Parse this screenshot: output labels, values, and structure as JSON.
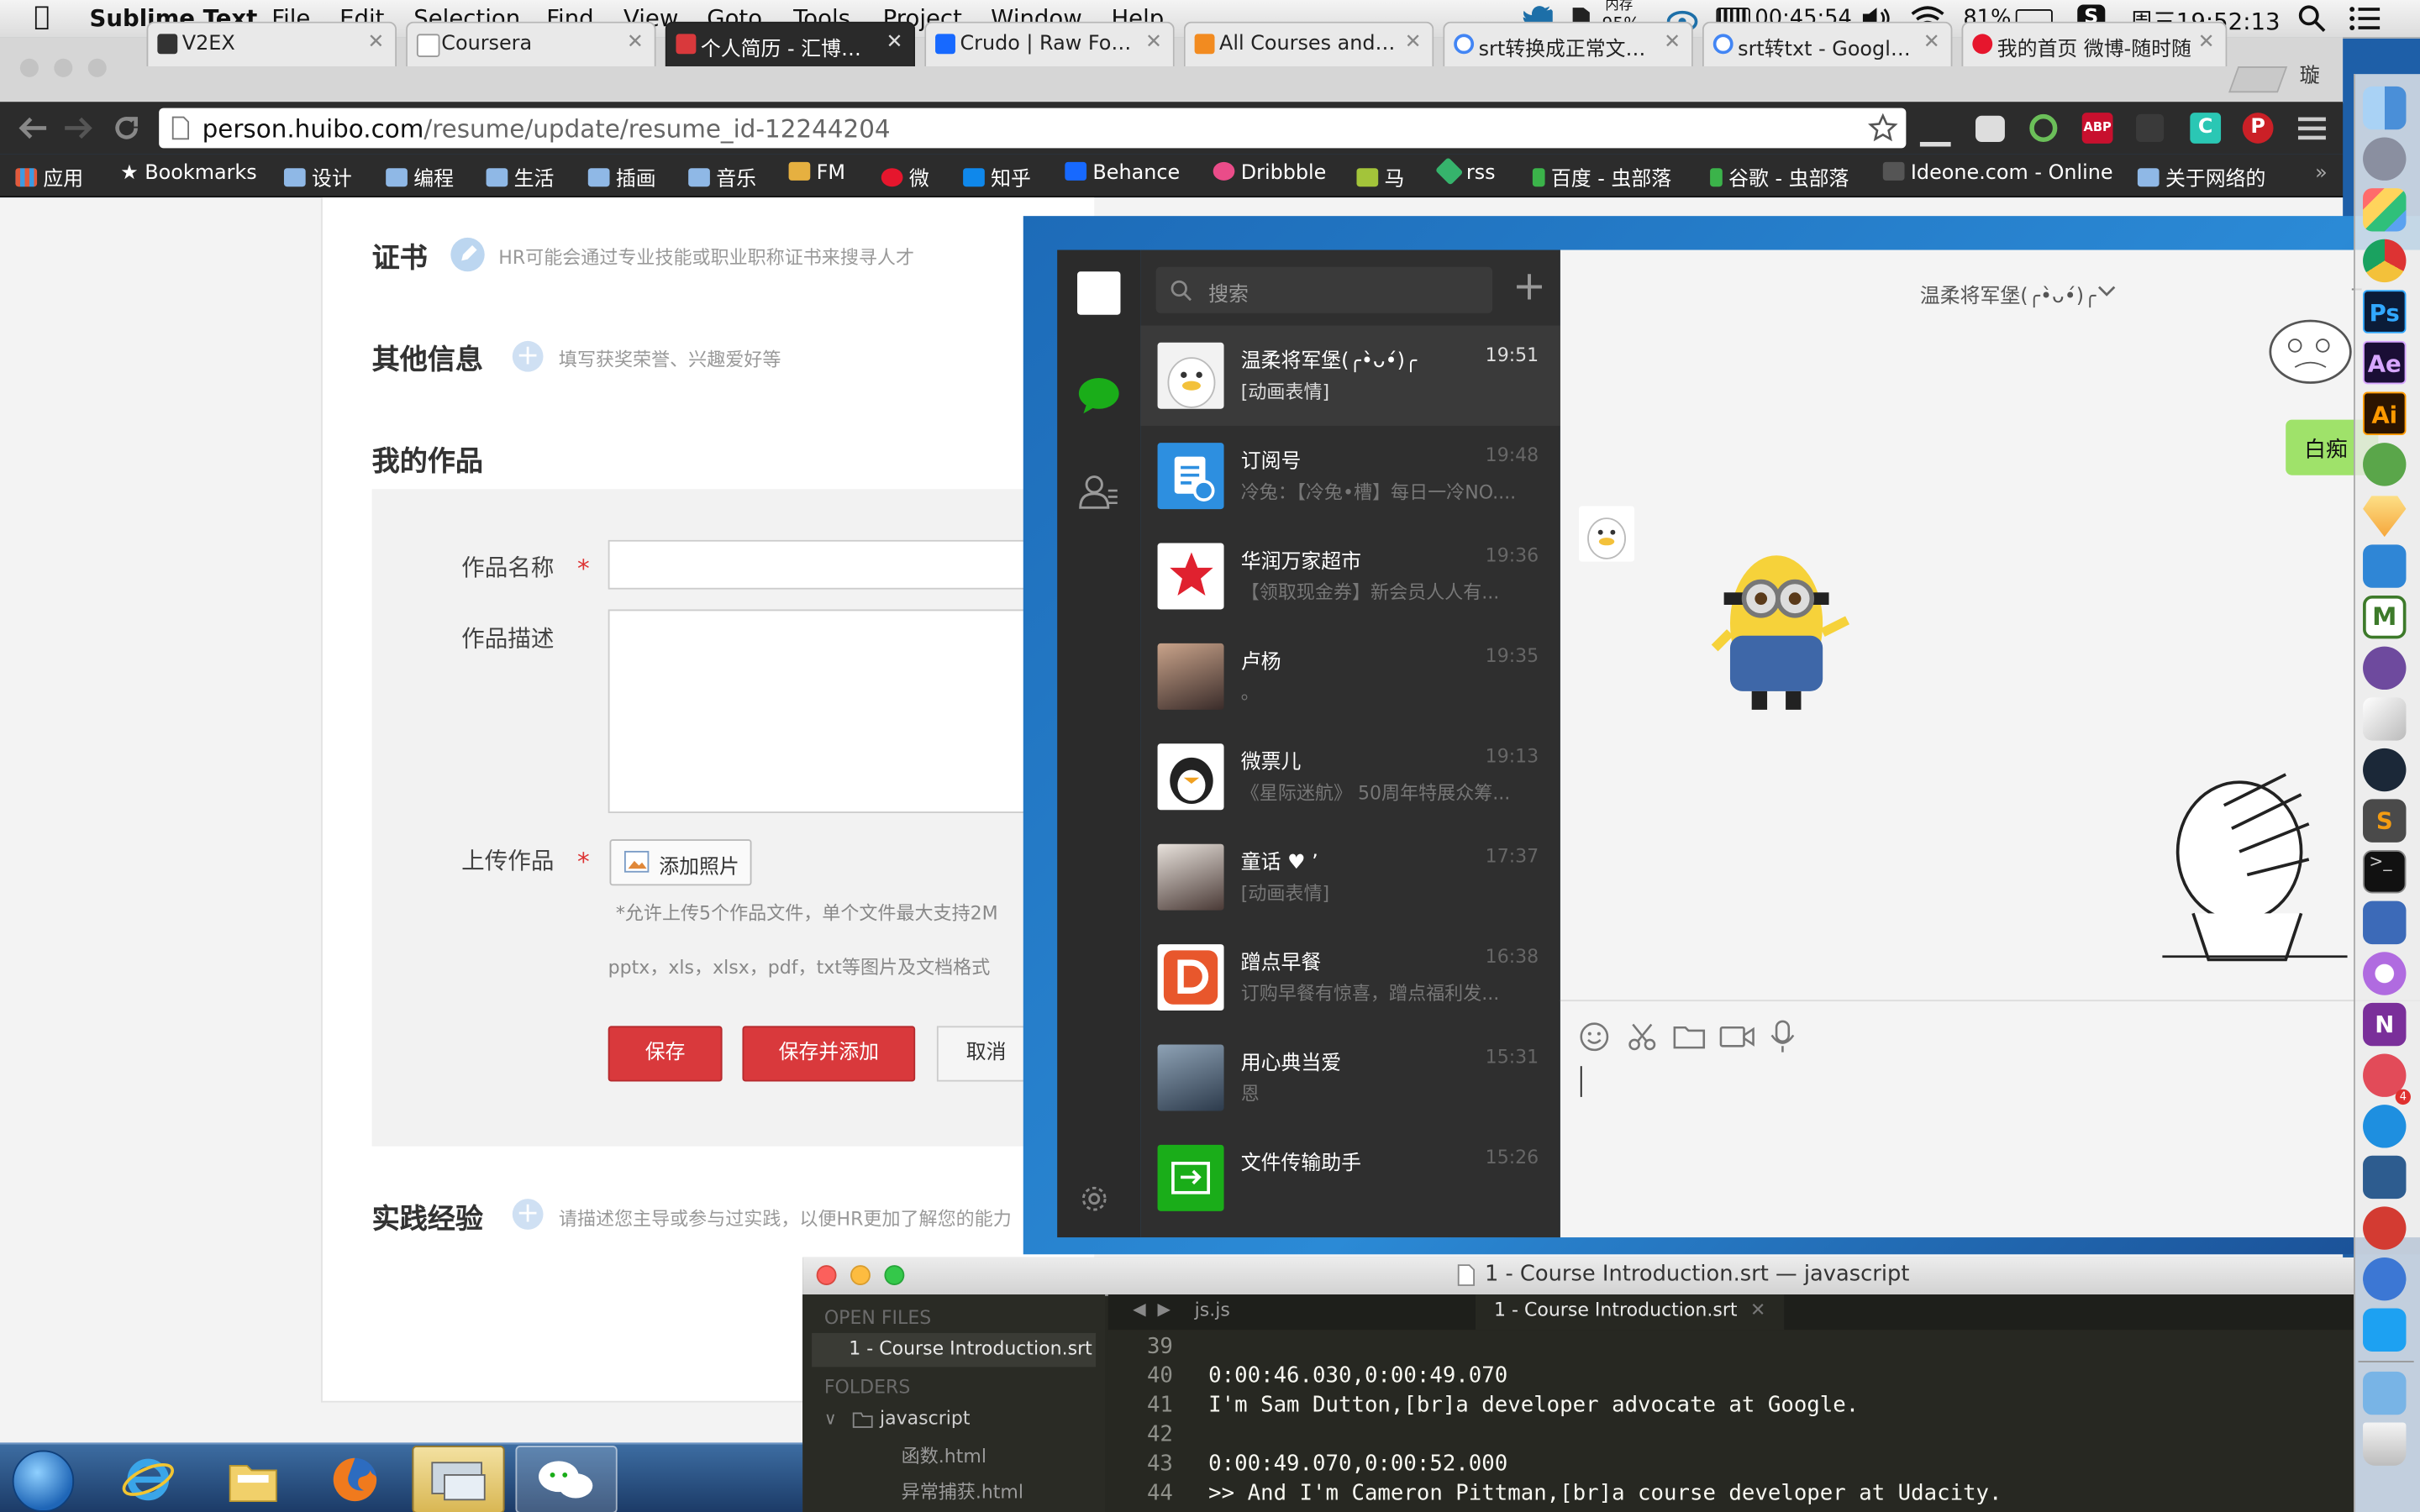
{
  "menubar": {
    "app": "Sublime Text",
    "items": [
      "File",
      "Edit",
      "Selection",
      "Find",
      "View",
      "Goto",
      "Tools",
      "Project",
      "Window",
      "Help"
    ],
    "mem_label": "内存",
    "mem_value": "95%",
    "timer": "00:45:54",
    "battery": "81%",
    "clock": "周三19:52:13"
  },
  "browser": {
    "tabs": [
      {
        "title": "V2EX",
        "favicon_color": "#333333"
      },
      {
        "title": "Coursera",
        "favicon_color": "#ffffff"
      },
      {
        "title": "个人简历 - 汇博人才网",
        "favicon_color": "#d9393c"
      },
      {
        "title": "Crudo | Raw Food F",
        "favicon_color": "#1769ff"
      },
      {
        "title": "All Courses and Na",
        "favicon_color": "#f28b20"
      },
      {
        "title": "srt转换成正常文本 -",
        "favicon_color": "#ffffff"
      },
      {
        "title": "srt转txt - Google 搜",
        "favicon_color": "#ffffff"
      },
      {
        "title": "我的首页 微博-随时随",
        "favicon_color": "#e6162d"
      }
    ],
    "new_tab_label": "璇",
    "url_host": "person.huibo.com",
    "url_path": "/resume/update/resume_id-12244204",
    "bookmarks": [
      {
        "label": "应用",
        "type": "apps"
      },
      {
        "label": "Bookmarks",
        "type": "star"
      },
      {
        "label": "设计",
        "type": "folder"
      },
      {
        "label": "编程",
        "type": "folder"
      },
      {
        "label": "生活",
        "type": "folder"
      },
      {
        "label": "插画",
        "type": "folder"
      },
      {
        "label": "音乐",
        "type": "folder"
      },
      {
        "label": "FM",
        "type": "fm"
      },
      {
        "label": "微",
        "type": "weibo"
      },
      {
        "label": "知乎",
        "type": "zhihu"
      },
      {
        "label": "Behance",
        "type": "behance"
      },
      {
        "label": "Dribbble",
        "type": "dribbble"
      },
      {
        "label": "马",
        "type": "ma"
      },
      {
        "label": "rss",
        "type": "rss"
      },
      {
        "label": "百度 - 虫部落",
        "type": "chong"
      },
      {
        "label": "谷歌 - 虫部落",
        "type": "chong"
      },
      {
        "label": "Ideone.com - Online",
        "type": "ideone"
      },
      {
        "label": "关于网络的",
        "type": "folder"
      }
    ]
  },
  "page": {
    "cert_title": "证书",
    "cert_hint": "HR可能会通过专业技能或职业职称证书来搜寻人才",
    "other_title": "其他信息",
    "other_hint": "填写获奖荣誉、兴趣爱好等",
    "works_title": "我的作品",
    "name_label": "作品名称",
    "desc_label": "作品描述",
    "upload_label": "上传作品",
    "required_mark": "*",
    "add_photo": "添加照片",
    "upload_note1": "*允许上传5个作品文件，单个文件最大支持2M",
    "upload_note2": "pptx，xls，xlsx，pdf，txt等图片及文档格式",
    "save": "保存",
    "save_add": "保存并添加",
    "cancel": "取消",
    "practice_title": "实践经验",
    "practice_hint": "请描述您主导或参与过实践，以便HR更加了解您的能力"
  },
  "wechat": {
    "search_placeholder": "搜索",
    "chat_title": "温柔将军堡(╭•̀ᴗ•́)╭",
    "bubble_text": "白痴",
    "conversations": [
      {
        "name": "温柔将军堡(╭•̀ᴗ•́)╭",
        "preview": "[动画表情]",
        "time": "19:51",
        "selected": true,
        "avatar": "duck"
      },
      {
        "name": "订阅号",
        "preview": "冷兔：【冷兔•槽】每日一冷NO....",
        "time": "19:48",
        "avatar": "sub"
      },
      {
        "name": "华润万家超市",
        "preview": "【领取现金券】新会员人人有...",
        "time": "19:36",
        "avatar": "vanguard"
      },
      {
        "name": "卢杨",
        "preview": "。",
        "time": "19:35",
        "avatar": "photo1"
      },
      {
        "name": "微票儿",
        "preview": "《星际迷航》 50周年特展众筹...",
        "time": "19:13",
        "avatar": "penguin"
      },
      {
        "name": "童话 ♥ ʼ",
        "preview": "[动画表情]",
        "time": "17:37",
        "avatar": "photo2"
      },
      {
        "name": "蹭点早餐",
        "preview": "订购早餐有惊喜，蹭点福利发...",
        "time": "16:38",
        "avatar": "dian"
      },
      {
        "name": "用心典当爱",
        "preview": "恩",
        "time": "15:31",
        "avatar": "photo3"
      },
      {
        "name": "文件传输助手",
        "preview": "",
        "time": "15:26",
        "avatar": "file"
      }
    ]
  },
  "sublime": {
    "window_title": "1 - Course Introduction.srt — javascript",
    "open_files_label": "OPEN FILES",
    "open_file": "1 - Course Introduction.srt",
    "folders_label": "FOLDERS",
    "folder": "javascript",
    "files": [
      "函数.html",
      "异常捕获.html"
    ],
    "tabs": [
      "js.js",
      "1 - Course Introduction.srt"
    ],
    "lines": [
      {
        "n": "39",
        "text": ""
      },
      {
        "n": "40",
        "text": "0:00:46.030,0:00:49.070"
      },
      {
        "n": "41",
        "text": "I'm Sam Dutton,[br]a developer advocate at Google."
      },
      {
        "n": "42",
        "text": ""
      },
      {
        "n": "43",
        "text": "0:00:49.070,0:00:52.000"
      },
      {
        "n": "44",
        "text": ">> And I'm Cameron Pittman,[br]a course developer at Udacity."
      }
    ]
  },
  "dock": [
    {
      "name": "finder",
      "color": "#4aa3ec"
    },
    {
      "name": "launchpad",
      "color": "#8a8fa0"
    },
    {
      "name": "stickies",
      "color": "#2fc07a"
    },
    {
      "name": "chrome",
      "color": "#e8c12d"
    },
    {
      "name": "photoshop",
      "color": "#2a3f73",
      "label": "Ps"
    },
    {
      "name": "after-effects",
      "color": "#3a2d66",
      "label": "Ae"
    },
    {
      "name": "illustrator",
      "color": "#4a2708",
      "label": "Ai"
    },
    {
      "name": "evernote",
      "color": "#5aa64a"
    },
    {
      "name": "sketch",
      "color": "#f6b73c"
    },
    {
      "name": "xcode",
      "color": "#2f86d6"
    },
    {
      "name": "mou",
      "color": "#3d7a2a"
    },
    {
      "name": "github",
      "color": "#6e4a9e"
    },
    {
      "name": "preview",
      "color": "#c8c8c8"
    },
    {
      "name": "steam",
      "color": "#1b2838"
    },
    {
      "name": "sublime",
      "color": "#5a5a5a",
      "label": "S"
    },
    {
      "name": "terminal",
      "color": "#1a1a1a"
    },
    {
      "name": "virtualbox",
      "color": "#3c6ab8"
    },
    {
      "name": "itunes",
      "color": "#b06be0"
    },
    {
      "name": "onenote",
      "color": "#7a2f9a"
    },
    {
      "name": "reeder",
      "color": "#e24b59"
    },
    {
      "name": "qq",
      "color": "#1e8fe0"
    },
    {
      "name": "screenshot",
      "color": "#2d5c8f"
    },
    {
      "name": "netease-music",
      "color": "#d33b32"
    },
    {
      "name": "weibo",
      "color": "#3c77d4"
    },
    {
      "name": "twitter",
      "color": "#1da1f2"
    },
    {
      "name": "downloads",
      "color": "#78b4e6"
    },
    {
      "name": "trash",
      "color": "#dcdcdc"
    }
  ],
  "taskbar": [
    "start",
    "ie",
    "explorer",
    "firefox",
    "desktop",
    "wechat"
  ],
  "colors": {
    "accent_red": "#d9393c",
    "wechat_green": "#1aad19",
    "sublime_bg": "#272822"
  }
}
